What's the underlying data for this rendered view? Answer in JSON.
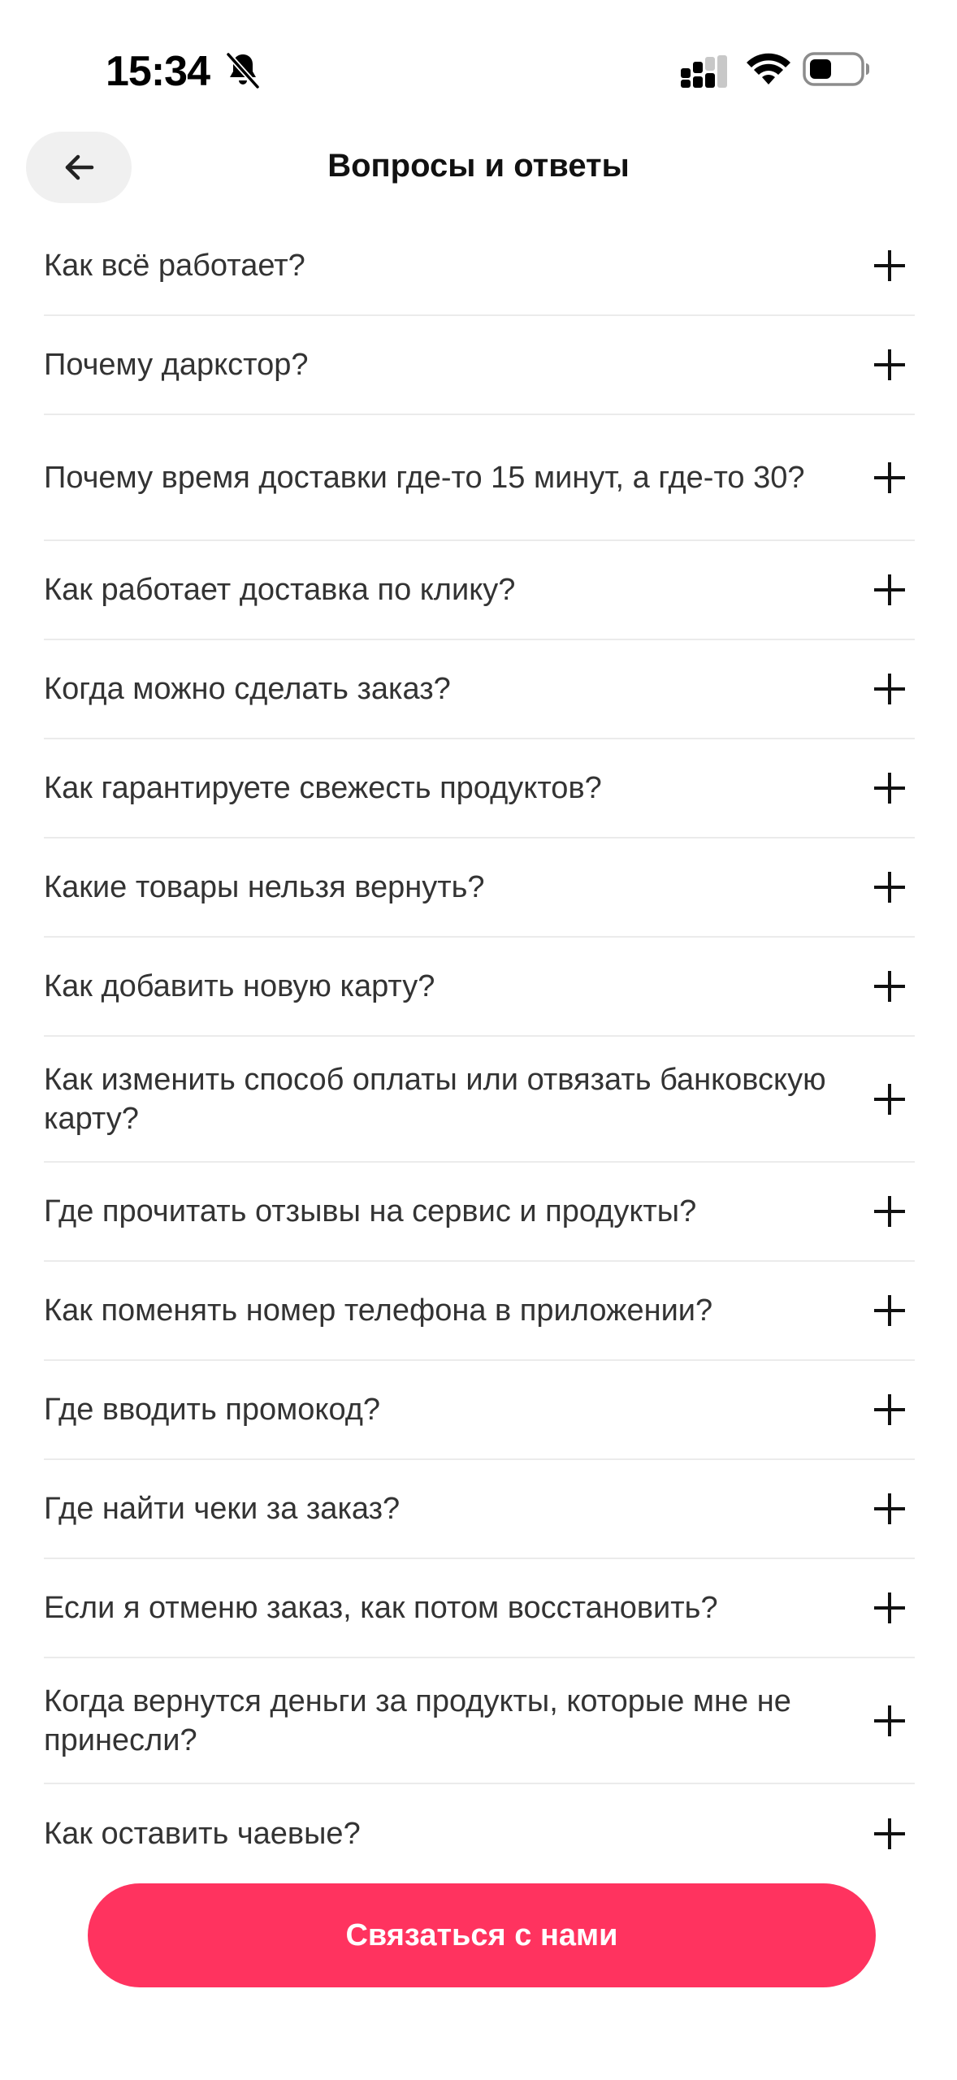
{
  "status_bar": {
    "time": "15:34"
  },
  "header": {
    "title": "Вопросы и ответы"
  },
  "faq": [
    {
      "question": "Как всё работает?"
    },
    {
      "question": "Почему даркстор?"
    },
    {
      "question": "Почему время доставки где-то 15 минут, а где-то 30?"
    },
    {
      "question": "Как работает доставка по клику?"
    },
    {
      "question": "Когда можно сделать заказ?"
    },
    {
      "question": "Как гарантируете свежесть продуктов?"
    },
    {
      "question": "Какие товары нельзя вернуть?"
    },
    {
      "question": "Как добавить новую карту?"
    },
    {
      "question": "Как изменить способ оплаты или отвязать банковскую карту?"
    },
    {
      "question": "Где прочитать отзывы на сервис и продукты?"
    },
    {
      "question": "Как поменять номер телефона в приложении?"
    },
    {
      "question": "Где вводить промокод?"
    },
    {
      "question": "Где найти чеки за заказ?"
    },
    {
      "question": "Если я отменю заказ, как потом восстановить?"
    },
    {
      "question": "Когда вернутся деньги за продукты, которые мне не принесли?"
    },
    {
      "question": "Как оставить чаевые?"
    }
  ],
  "footer": {
    "contact_label": "Связаться с нами"
  },
  "colors": {
    "accent": "#ff335f",
    "text": "#333333",
    "divider": "#ebebeb",
    "back_button_bg": "#f0f0f0"
  },
  "icons": [
    "bell-slash-icon",
    "signal-icon",
    "wifi-icon",
    "battery-icon",
    "arrow-left-icon",
    "plus-icon"
  ]
}
